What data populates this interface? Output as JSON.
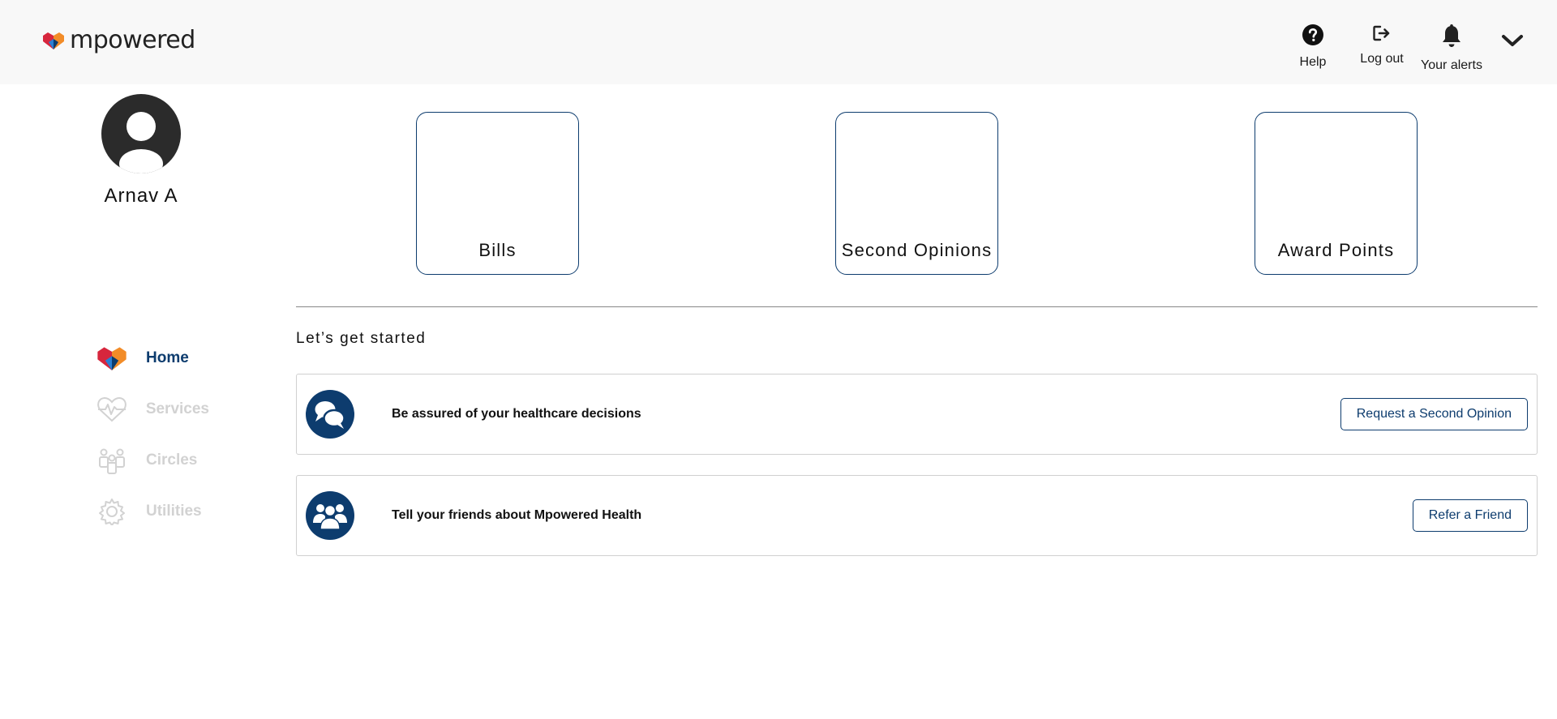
{
  "brand": {
    "name": "mpowered"
  },
  "topnav": {
    "help": {
      "label": "Help",
      "icon": "question-circle-icon"
    },
    "logout": {
      "label": "Log out",
      "icon": "logout-icon"
    },
    "alerts": {
      "label": "Your alerts",
      "icon": "bell-icon"
    },
    "menu": {
      "icon": "chevron-down-icon"
    }
  },
  "profile": {
    "name": "Arnav A",
    "icon": "user-avatar-icon"
  },
  "sidebar": {
    "items": [
      {
        "label": "Home",
        "icon": "heart-logo-icon",
        "active": true
      },
      {
        "label": "Services",
        "icon": "heartbeat-icon",
        "active": false
      },
      {
        "label": "Circles",
        "icon": "people-group-icon",
        "active": false
      },
      {
        "label": "Utilities",
        "icon": "gear-icon",
        "active": false
      }
    ]
  },
  "tiles": [
    {
      "label": "Bills"
    },
    {
      "label": "Second Opinions"
    },
    {
      "label": "Award Points"
    }
  ],
  "section": {
    "title": "Let’s get started"
  },
  "cards": [
    {
      "text": "Be assured of your healthcare decisions",
      "button": "Request a Second Opinion",
      "icon": "chat-bubbles-icon"
    },
    {
      "text": "Tell your friends about Mpowered Health",
      "button": "Refer a Friend",
      "icon": "users-group-icon"
    }
  ],
  "colors": {
    "primary": "#0d3c6e",
    "topbar_bg": "#f8f8f8",
    "inactive_text": "#d2d2d2"
  }
}
